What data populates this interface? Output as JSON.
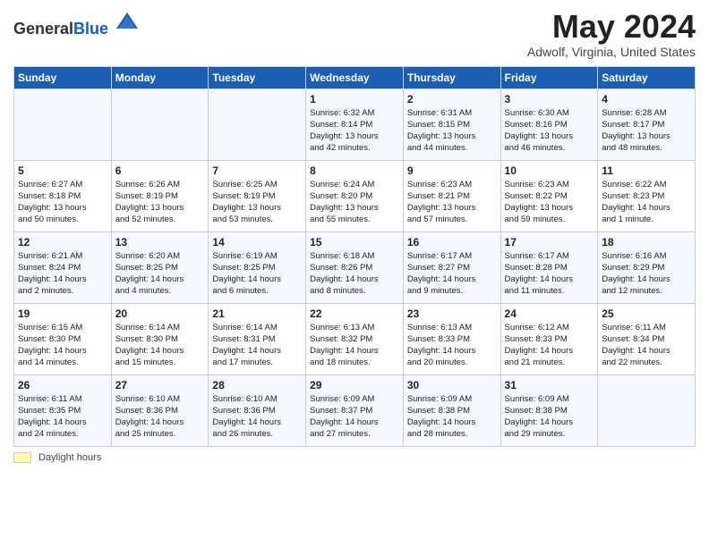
{
  "header": {
    "logo_line1": "General",
    "logo_line2": "Blue",
    "month_title": "May 2024",
    "location": "Adwolf, Virginia, United States"
  },
  "footer": {
    "daylight_label": "Daylight hours"
  },
  "weekdays": [
    "Sunday",
    "Monday",
    "Tuesday",
    "Wednesday",
    "Thursday",
    "Friday",
    "Saturday"
  ],
  "weeks": [
    [
      {
        "day": "",
        "info": ""
      },
      {
        "day": "",
        "info": ""
      },
      {
        "day": "",
        "info": ""
      },
      {
        "day": "1",
        "info": "Sunrise: 6:32 AM\nSunset: 8:14 PM\nDaylight: 13 hours\nand 42 minutes."
      },
      {
        "day": "2",
        "info": "Sunrise: 6:31 AM\nSunset: 8:15 PM\nDaylight: 13 hours\nand 44 minutes."
      },
      {
        "day": "3",
        "info": "Sunrise: 6:30 AM\nSunset: 8:16 PM\nDaylight: 13 hours\nand 46 minutes."
      },
      {
        "day": "4",
        "info": "Sunrise: 6:28 AM\nSunset: 8:17 PM\nDaylight: 13 hours\nand 48 minutes."
      }
    ],
    [
      {
        "day": "5",
        "info": "Sunrise: 6:27 AM\nSunset: 8:18 PM\nDaylight: 13 hours\nand 50 minutes."
      },
      {
        "day": "6",
        "info": "Sunrise: 6:26 AM\nSunset: 8:19 PM\nDaylight: 13 hours\nand 52 minutes."
      },
      {
        "day": "7",
        "info": "Sunrise: 6:25 AM\nSunset: 8:19 PM\nDaylight: 13 hours\nand 53 minutes."
      },
      {
        "day": "8",
        "info": "Sunrise: 6:24 AM\nSunset: 8:20 PM\nDaylight: 13 hours\nand 55 minutes."
      },
      {
        "day": "9",
        "info": "Sunrise: 6:23 AM\nSunset: 8:21 PM\nDaylight: 13 hours\nand 57 minutes."
      },
      {
        "day": "10",
        "info": "Sunrise: 6:23 AM\nSunset: 8:22 PM\nDaylight: 13 hours\nand 59 minutes."
      },
      {
        "day": "11",
        "info": "Sunrise: 6:22 AM\nSunset: 8:23 PM\nDaylight: 14 hours\nand 1 minute."
      }
    ],
    [
      {
        "day": "12",
        "info": "Sunrise: 6:21 AM\nSunset: 8:24 PM\nDaylight: 14 hours\nand 2 minutes."
      },
      {
        "day": "13",
        "info": "Sunrise: 6:20 AM\nSunset: 8:25 PM\nDaylight: 14 hours\nand 4 minutes."
      },
      {
        "day": "14",
        "info": "Sunrise: 6:19 AM\nSunset: 8:25 PM\nDaylight: 14 hours\nand 6 minutes."
      },
      {
        "day": "15",
        "info": "Sunrise: 6:18 AM\nSunset: 8:26 PM\nDaylight: 14 hours\nand 8 minutes."
      },
      {
        "day": "16",
        "info": "Sunrise: 6:17 AM\nSunset: 8:27 PM\nDaylight: 14 hours\nand 9 minutes."
      },
      {
        "day": "17",
        "info": "Sunrise: 6:17 AM\nSunset: 8:28 PM\nDaylight: 14 hours\nand 11 minutes."
      },
      {
        "day": "18",
        "info": "Sunrise: 6:16 AM\nSunset: 8:29 PM\nDaylight: 14 hours\nand 12 minutes."
      }
    ],
    [
      {
        "day": "19",
        "info": "Sunrise: 6:15 AM\nSunset: 8:30 PM\nDaylight: 14 hours\nand 14 minutes."
      },
      {
        "day": "20",
        "info": "Sunrise: 6:14 AM\nSunset: 8:30 PM\nDaylight: 14 hours\nand 15 minutes."
      },
      {
        "day": "21",
        "info": "Sunrise: 6:14 AM\nSunset: 8:31 PM\nDaylight: 14 hours\nand 17 minutes."
      },
      {
        "day": "22",
        "info": "Sunrise: 6:13 AM\nSunset: 8:32 PM\nDaylight: 14 hours\nand 18 minutes."
      },
      {
        "day": "23",
        "info": "Sunrise: 6:13 AM\nSunset: 8:33 PM\nDaylight: 14 hours\nand 20 minutes."
      },
      {
        "day": "24",
        "info": "Sunrise: 6:12 AM\nSunset: 8:33 PM\nDaylight: 14 hours\nand 21 minutes."
      },
      {
        "day": "25",
        "info": "Sunrise: 6:11 AM\nSunset: 8:34 PM\nDaylight: 14 hours\nand 22 minutes."
      }
    ],
    [
      {
        "day": "26",
        "info": "Sunrise: 6:11 AM\nSunset: 8:35 PM\nDaylight: 14 hours\nand 24 minutes."
      },
      {
        "day": "27",
        "info": "Sunrise: 6:10 AM\nSunset: 8:36 PM\nDaylight: 14 hours\nand 25 minutes."
      },
      {
        "day": "28",
        "info": "Sunrise: 6:10 AM\nSunset: 8:36 PM\nDaylight: 14 hours\nand 26 minutes."
      },
      {
        "day": "29",
        "info": "Sunrise: 6:09 AM\nSunset: 8:37 PM\nDaylight: 14 hours\nand 27 minutes."
      },
      {
        "day": "30",
        "info": "Sunrise: 6:09 AM\nSunset: 8:38 PM\nDaylight: 14 hours\nand 28 minutes."
      },
      {
        "day": "31",
        "info": "Sunrise: 6:09 AM\nSunset: 8:38 PM\nDaylight: 14 hours\nand 29 minutes."
      },
      {
        "day": "",
        "info": ""
      }
    ]
  ]
}
